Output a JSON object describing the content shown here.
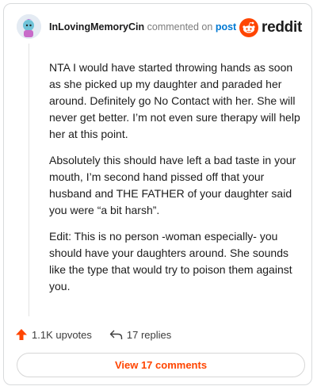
{
  "comment": {
    "username": "InLovingMemoryCin",
    "action_text": "commented on",
    "post_link": "post",
    "paragraphs": [
      "NTA I would have started throwing hands as soon as she picked up my daughter and paraded her around. Definitely go No Contact with her. She will never get better. I’m not even sure therapy will help her at this point.",
      "Absolutely this should have left a bad taste in your mouth, I’m second hand pissed off that your husband and THE FATHER of your daughter said you were “a bit harsh”.",
      "Edit: This is no person -woman especially- you should have your daughters around. She sounds like the type that would try to poison them against you."
    ],
    "upvotes": "1.1K upvotes",
    "replies": "17 replies"
  },
  "brand": {
    "name": "reddit",
    "icon": "reddit-alien-icon",
    "accent": "#ff4500"
  },
  "footer": {
    "view_label": "View 17 comments"
  },
  "colors": {
    "link": "#0079d3",
    "text": "#1c1c1c",
    "muted": "#7c7c7c"
  }
}
